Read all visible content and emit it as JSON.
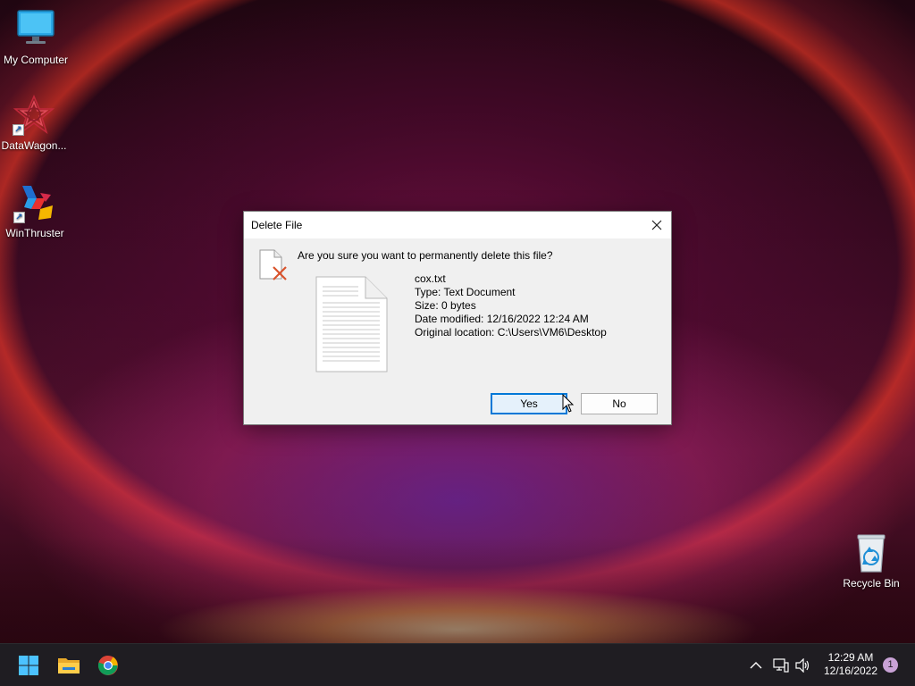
{
  "desktop": {
    "icons": [
      {
        "label": "My Computer",
        "icon": "monitor-icon"
      },
      {
        "label": "DataWagon...",
        "icon": "datawagon-icon"
      },
      {
        "label": "WinThruster",
        "icon": "winthruster-icon"
      },
      {
        "label": "Recycle Bin",
        "icon": "recycle-bin-icon"
      }
    ]
  },
  "dialog": {
    "title": "Delete File",
    "question": "Are you sure you want to permanently delete this file?",
    "file": {
      "name": "cox.txt",
      "type": "Type: Text Document",
      "size": "Size: 0 bytes",
      "modified": "Date modified: 12/16/2022 12:24 AM",
      "location": "Original location: C:\\Users\\VM6\\Desktop"
    },
    "yes_label": "Yes",
    "no_label": "No"
  },
  "taskbar": {
    "apps": [
      "start-icon",
      "file-explorer-icon",
      "chrome-icon"
    ],
    "tray": [
      "chevron-up-icon",
      "network-icon",
      "volume-icon"
    ],
    "clock_time": "12:29 AM",
    "clock_date": "12/16/2022",
    "notification_count": "1"
  },
  "colors": {
    "accent": "#0078d7",
    "taskbar": "#1f1d22",
    "dialog_bg": "#f0f0f0"
  }
}
